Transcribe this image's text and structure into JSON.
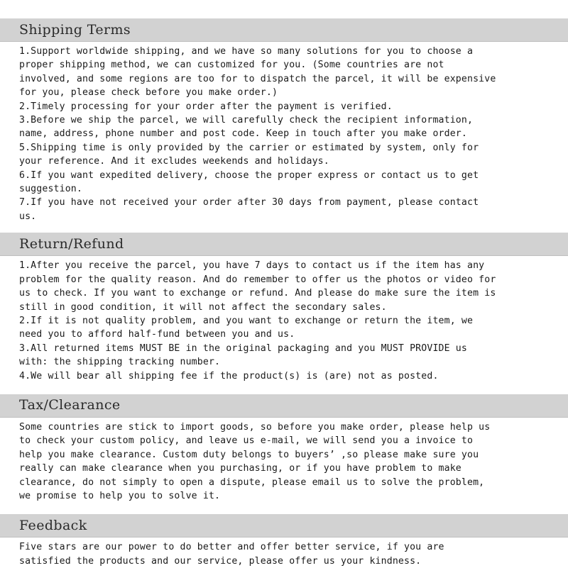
{
  "document": {
    "type": "shipping-policy",
    "header_band_color": "#d2d2d2",
    "text_color": "#1a1a1a",
    "background_color": "#ffffff"
  },
  "sections": [
    {
      "id": "shipping-terms",
      "title": "Shipping Terms",
      "lines": [
        "1.Support worldwide shipping, and we have so many solutions for you to choose a",
        "proper shipping method, we can customized for you. (Some countries are not",
        "involved, and some regions are too for to dispatch the parcel, it will be expensive",
        "for you, please check before you make order.)",
        "2.Timely processing for your order after the payment is verified.",
        "3.Before we ship the parcel, we will carefully check the recipient information,",
        "name, address, phone number and post code. Keep in touch after you make order.",
        "5.Shipping time is only provided by the carrier or estimated by system, only for",
        "your reference. And it excludes weekends and holidays.",
        "6.If you want expedited delivery, choose the proper express or contact us to get",
        "suggestion.",
        "7.If you have not received your order after 30 days from payment, please contact",
        "us."
      ]
    },
    {
      "id": "return-refund",
      "title": "Return/Refund",
      "lines": [
        "1.After you receive the parcel, you have 7 days to contact us if the item has any",
        "problem for the quality reason. And do remember to offer us the photos or video for",
        "us to check. If you want to exchange or refund. And please do make sure the item is",
        "still in good condition, it will not affect the secondary sales.",
        "2.If it is not quality problem, and you want to exchange or return the item, we",
        "need you to afford half-fund between you and us.",
        "3.All returned items MUST BE in the original packaging and you MUST PROVIDE us",
        "with: the shipping tracking number.",
        "4.We will bear all shipping fee if the product(s) is (are) not as posted."
      ]
    },
    {
      "id": "tax-clearance",
      "title": "Tax/Clearance",
      "lines": [
        "Some countries are stick to import goods, so before you make order, please help us",
        "to check your custom policy, and leave us e-mail, we will send you a invoice to",
        "help you make clearance. Custom duty belongs to buyers’ ,so please make sure you",
        "really can make clearance when you purchasing, or if you have problem to make",
        "clearance, do not simply to open a dispute, please email us to solve the problem,",
        "we promise to help you to solve it."
      ]
    },
    {
      "id": "feedback",
      "title": "Feedback",
      "lines": [
        "Five stars are our power to do better and offer better service, if you are",
        "satisfied the products and our service, please offer us your kindness."
      ]
    }
  ]
}
